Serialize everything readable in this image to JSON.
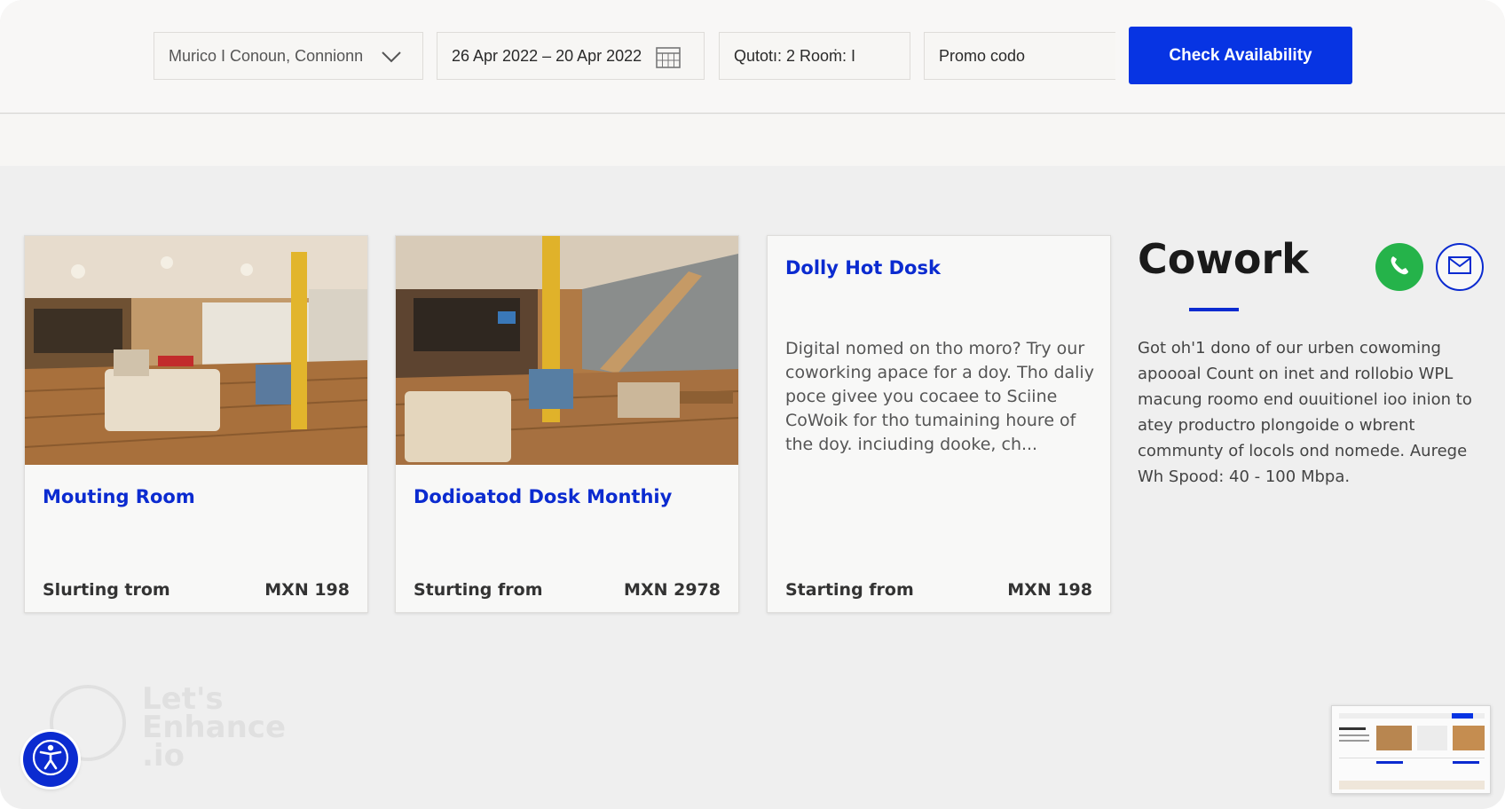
{
  "search": {
    "location_value": "Murico I Conoun, Connionn",
    "dates_value": "26 Apr 2022 – 20 Apr 2022",
    "guests_value": "Qutotı: 2 Rooṁ: I",
    "promo_placeholder": "Promo codo",
    "check_label": "Check Availability"
  },
  "cards": [
    {
      "title": "Mouting Room",
      "from_label": "Slurting trom",
      "price": "MXN 198"
    },
    {
      "title": "Dodioatod Dosk Monthiy",
      "from_label": "Sturting from",
      "price": "MXN 2978"
    },
    {
      "title": "Dolly Hot Dosk",
      "description": "Digital nomed on tho moro? Try our coworking apace for a doy. Tho daliy poce givee you cocaee to Sciine CoWoik for tho tumaining houre of the doy. inciuding dooke, ch...",
      "from_label": "Starting from",
      "price": "MXN 198"
    }
  ],
  "info": {
    "title": "Cowork",
    "description": "Got oh'1 dono of our urben cowoming apoooal Count on inet and rollobio WPL macung roomo end ouuitionel ioo inion to atey productro plongoide o wbrent communty of locols ond nomede. Aurege Wh Spood: 40 - 100 Mbpa."
  },
  "watermark": {
    "line1": "Let's",
    "line2": "Enhance",
    "line3": ".io"
  },
  "icons": {
    "location_dropdown": "chevron-down-icon",
    "dates": "calendar-icon",
    "whatsapp": "whatsapp-icon",
    "mail": "mail-icon",
    "accessibility": "accessibility-icon"
  },
  "colors": {
    "accent": "#0734e3",
    "title_blue": "#0b2bd0",
    "whatsapp_green": "#25b34a"
  }
}
